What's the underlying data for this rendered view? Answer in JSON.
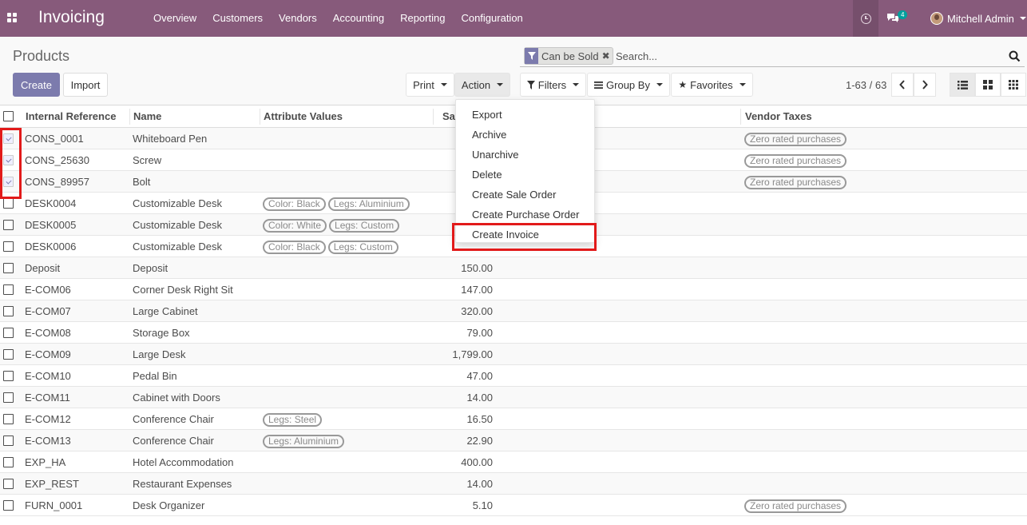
{
  "navbar": {
    "brand": "Invoicing",
    "menu": [
      "Overview",
      "Customers",
      "Vendors",
      "Accounting",
      "Reporting",
      "Configuration"
    ],
    "chat_count": "4",
    "user_name": "Mitchell Admin"
  },
  "control_panel": {
    "breadcrumb": "Products",
    "facet_label": "Can be Sold",
    "search_placeholder": "Search...",
    "create_label": "Create",
    "import_label": "Import",
    "print_label": "Print",
    "action_label": "Action",
    "filters_label": "Filters",
    "groupby_label": "Group By",
    "favorites_label": "Favorites",
    "pager": "1-63 / 63"
  },
  "table": {
    "headers": [
      "Internal Reference",
      "Name",
      "Attribute Values",
      "Sa",
      "Vendor Taxes"
    ],
    "rows": [
      {
        "ref": "CONS_0001",
        "name": "Whiteboard Pen",
        "attrs": [],
        "price": "",
        "vendor_tax": "Zero rated purchases",
        "checked": true
      },
      {
        "ref": "CONS_25630",
        "name": "Screw",
        "attrs": [],
        "price": "",
        "vendor_tax": "Zero rated purchases",
        "checked": true
      },
      {
        "ref": "CONS_89957",
        "name": "Bolt",
        "attrs": [],
        "price": "",
        "vendor_tax": "Zero rated purchases",
        "checked": true
      },
      {
        "ref": "DESK0004",
        "name": "Customizable Desk",
        "attrs": [
          "Color: Black",
          "Legs: Aluminium"
        ],
        "price": "",
        "vendor_tax": "",
        "checked": false
      },
      {
        "ref": "DESK0005",
        "name": "Customizable Desk",
        "attrs": [
          "Color: White",
          "Legs: Custom"
        ],
        "price": "",
        "vendor_tax": "",
        "checked": false
      },
      {
        "ref": "DESK0006",
        "name": "Customizable Desk",
        "attrs": [
          "Color: Black",
          "Legs: Custom"
        ],
        "price": "",
        "vendor_tax": "",
        "checked": false
      },
      {
        "ref": "Deposit",
        "name": "Deposit",
        "attrs": [],
        "price": "150.00",
        "vendor_tax": "",
        "checked": false
      },
      {
        "ref": "E-COM06",
        "name": "Corner Desk Right Sit",
        "attrs": [],
        "price": "147.00",
        "vendor_tax": "",
        "checked": false
      },
      {
        "ref": "E-COM07",
        "name": "Large Cabinet",
        "attrs": [],
        "price": "320.00",
        "vendor_tax": "",
        "checked": false
      },
      {
        "ref": "E-COM08",
        "name": "Storage Box",
        "attrs": [],
        "price": "79.00",
        "vendor_tax": "",
        "checked": false
      },
      {
        "ref": "E-COM09",
        "name": "Large Desk",
        "attrs": [],
        "price": "1,799.00",
        "vendor_tax": "",
        "checked": false
      },
      {
        "ref": "E-COM10",
        "name": "Pedal Bin",
        "attrs": [],
        "price": "47.00",
        "vendor_tax": "",
        "checked": false
      },
      {
        "ref": "E-COM11",
        "name": "Cabinet with Doors",
        "attrs": [],
        "price": "14.00",
        "vendor_tax": "",
        "checked": false
      },
      {
        "ref": "E-COM12",
        "name": "Conference Chair",
        "attrs": [
          "Legs: Steel"
        ],
        "price": "16.50",
        "vendor_tax": "",
        "checked": false
      },
      {
        "ref": "E-COM13",
        "name": "Conference Chair",
        "attrs": [
          "Legs: Aluminium"
        ],
        "price": "22.90",
        "vendor_tax": "",
        "checked": false
      },
      {
        "ref": "EXP_HA",
        "name": "Hotel Accommodation",
        "attrs": [],
        "price": "400.00",
        "vendor_tax": "",
        "checked": false
      },
      {
        "ref": "EXP_REST",
        "name": "Restaurant Expenses",
        "attrs": [],
        "price": "14.00",
        "vendor_tax": "",
        "checked": false
      },
      {
        "ref": "FURN_0001",
        "name": "Desk Organizer",
        "attrs": [],
        "price": "5.10",
        "vendor_tax": "Zero rated purchases",
        "checked": false
      }
    ]
  },
  "action_menu": [
    "Export",
    "Archive",
    "Unarchive",
    "Delete",
    "Create Sale Order",
    "Create Purchase Order",
    "Create Invoice"
  ],
  "colors": {
    "navbar": "#875a7b",
    "primary": "#7c7bad",
    "highlight": "#e21a1a"
  }
}
